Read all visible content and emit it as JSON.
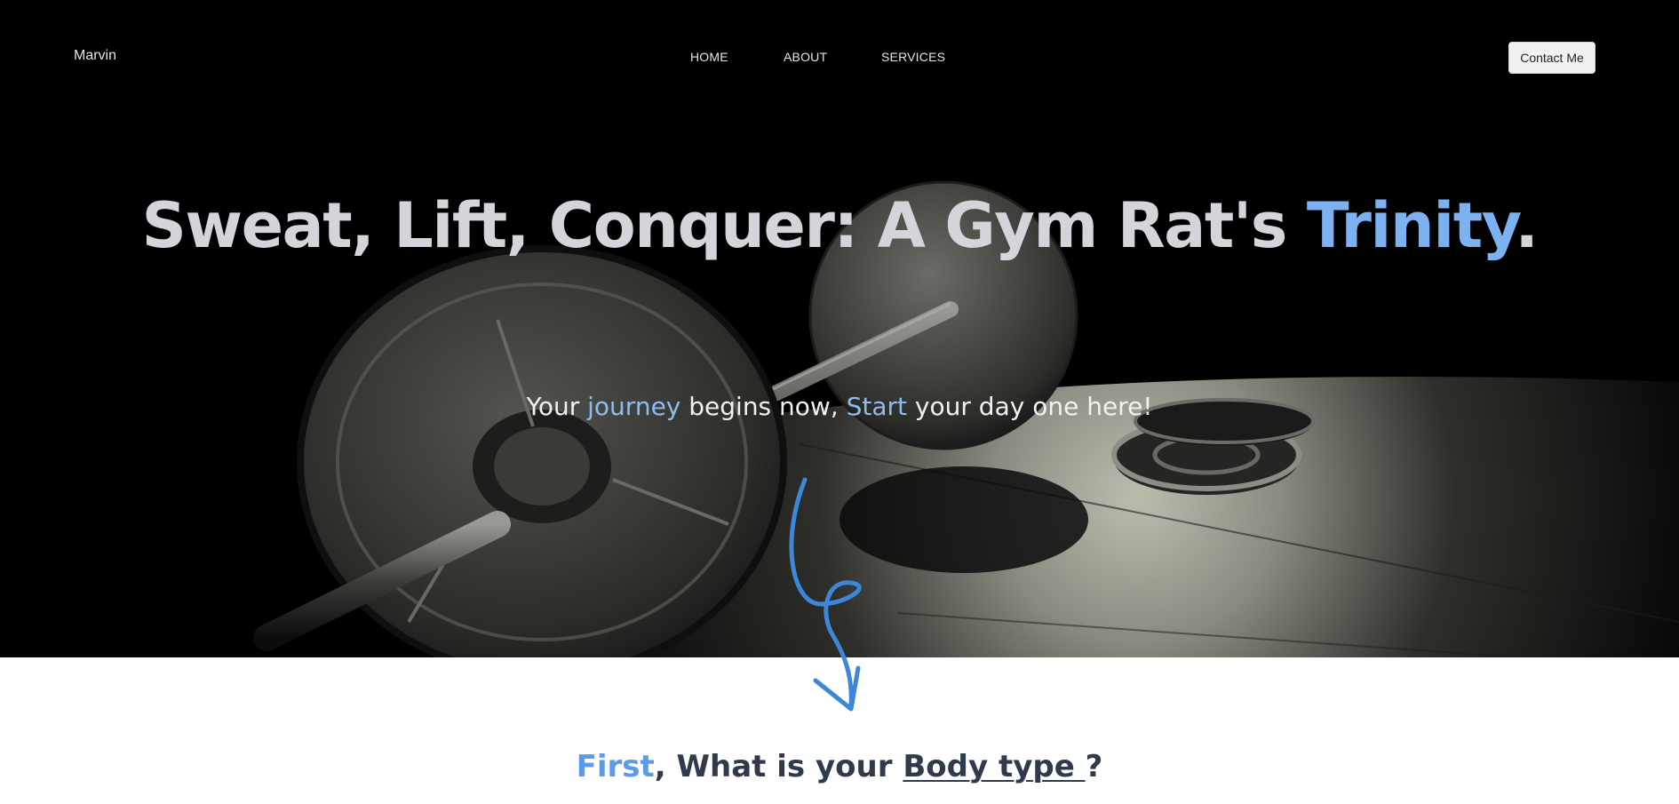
{
  "header": {
    "brand": "Marvin",
    "nav": [
      "HOME",
      "ABOUT",
      "SERVICES"
    ],
    "contact_label": "Contact Me"
  },
  "hero": {
    "headline_part1": "Sweat, Lift, Conquer: A Gym Rat's ",
    "headline_accent": "Trinity",
    "headline_end": ".",
    "sub_part1": "Your ",
    "sub_accent1": "journey",
    "sub_part2": " begins now, ",
    "sub_accent2": "Start",
    "sub_part3": " your day one here!",
    "image_icon": "barbell-photo"
  },
  "section": {
    "arrow_icon": "curly-arrow-down-icon",
    "question_accent": "First",
    "question_part1": ", What is your ",
    "question_underlined": "Body type ",
    "question_end": "?"
  },
  "colors": {
    "accent": "#7cb1f2",
    "accent_dark": "#5b9bea",
    "heading_dark": "#2f3a4d",
    "arrow": "#3d87d9"
  }
}
